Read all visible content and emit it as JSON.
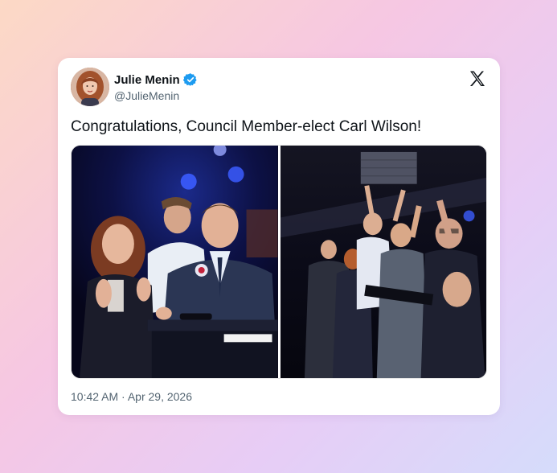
{
  "tweet": {
    "author": {
      "display_name": "Julie Menin",
      "handle": "@JulieMenin",
      "verified": true,
      "avatar_icon": "profile-photo"
    },
    "text": "Congratulations, Council Member-elect Carl Wilson!",
    "timestamp": "10:42 AM · Apr 29, 2026",
    "platform_icon": "x-logo-icon",
    "media_count": 2
  },
  "colors": {
    "verified_badge": "#1d9bf0",
    "text_primary": "#0f1419",
    "text_secondary": "#536471",
    "card_bg": "#ffffff"
  }
}
